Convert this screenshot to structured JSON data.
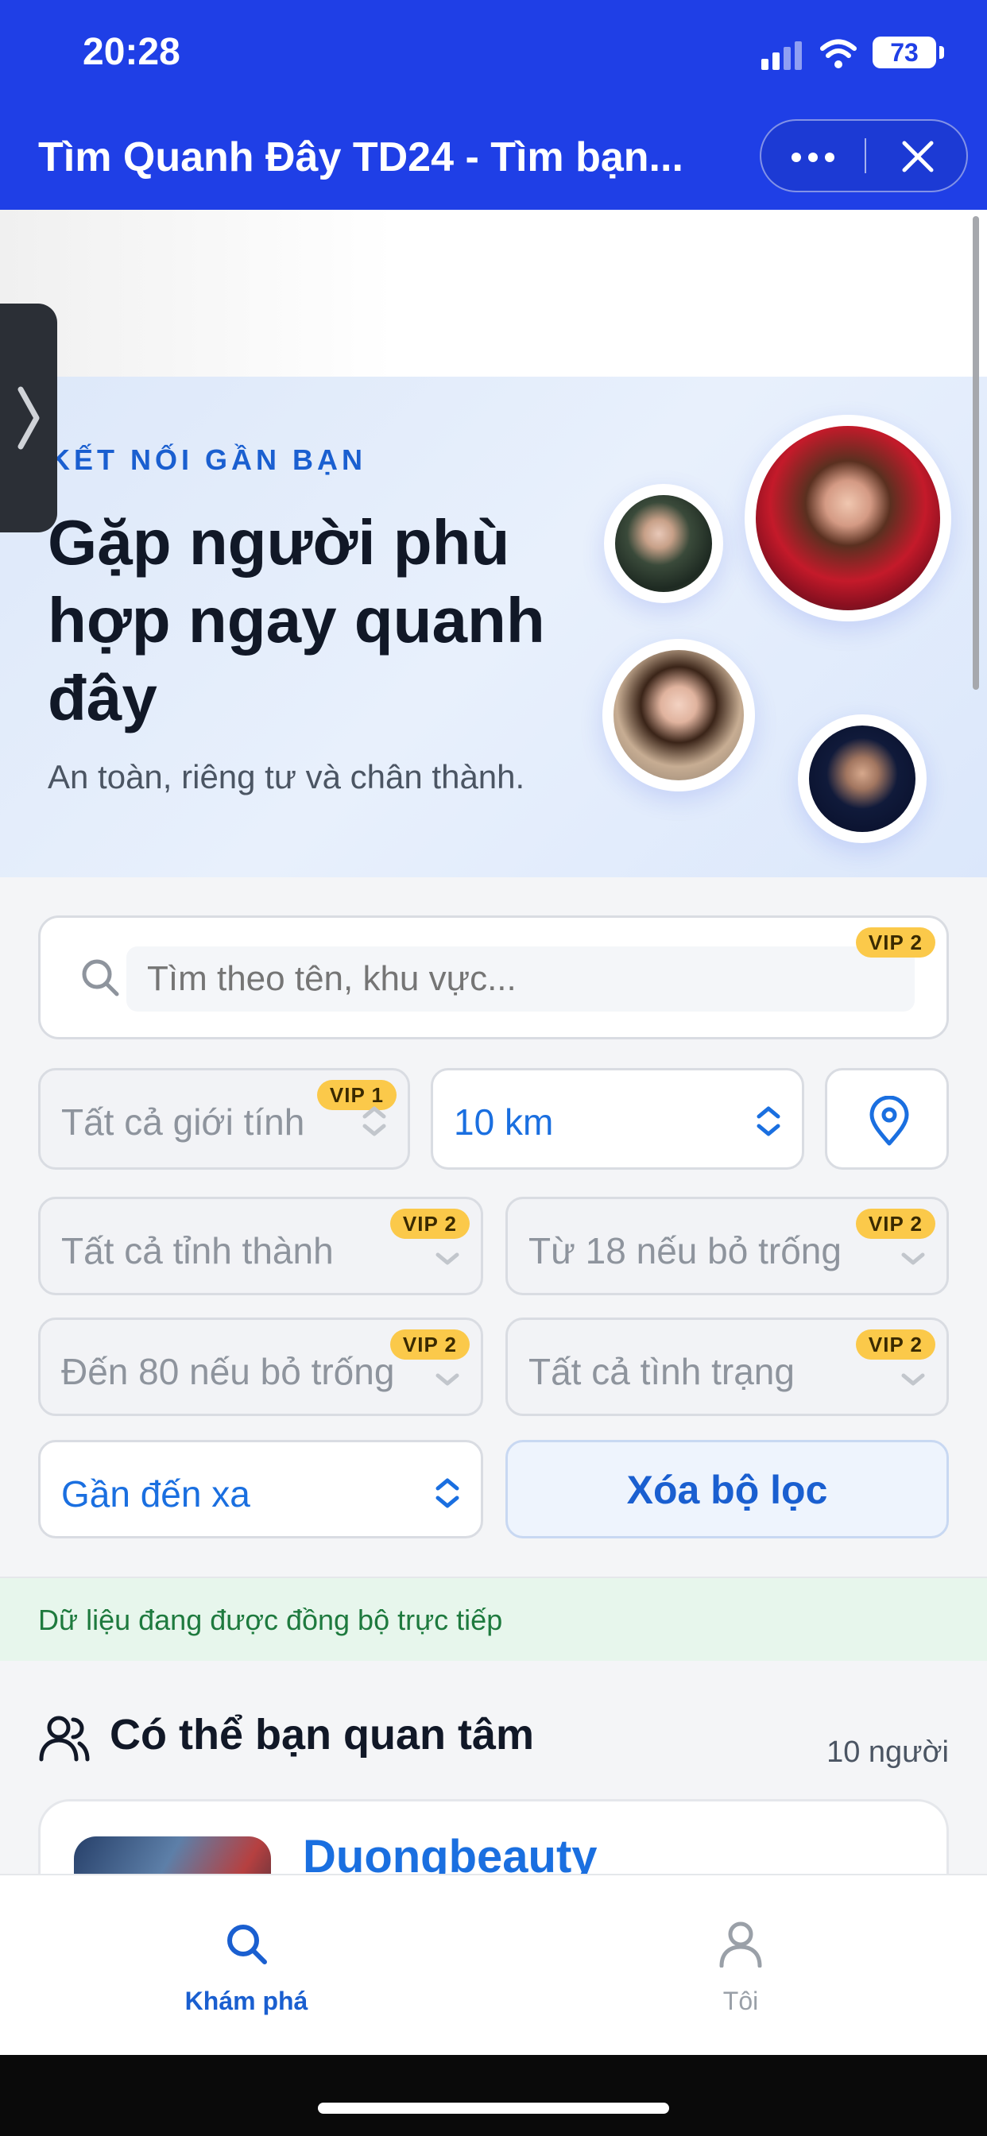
{
  "status_bar": {
    "time": "20:28",
    "battery": "73"
  },
  "header": {
    "title": "Tìm Quanh Đây TD24 - Tìm bạn..."
  },
  "hero": {
    "eyebrow": "KẾT NỐI GẦN BẠN",
    "title": "Gặp người phù hợp ngay quanh đây",
    "subtitle": "An toàn, riêng tư và chân thành."
  },
  "search": {
    "placeholder": "Tìm theo tên, khu vực...",
    "badge": "VIP 2"
  },
  "filters": {
    "gender": {
      "value": "Tất cả giới tính",
      "badge": "VIP 1"
    },
    "distance": {
      "value": "10 km"
    },
    "province": {
      "value": "Tất cả tỉnh thành",
      "badge": "VIP 2"
    },
    "age_from": {
      "value": "Từ 18 nếu bỏ trống",
      "badge": "VIP 2"
    },
    "age_to": {
      "value": "Đến 80 nếu bỏ trống",
      "badge": "VIP 2"
    },
    "status": {
      "value": "Tất cả tình trạng",
      "badge": "VIP 2"
    },
    "sort": {
      "value": "Gần đến xa"
    },
    "clear_label": "Xóa bộ lọc"
  },
  "sync_notice": "Dữ liệu đang được đồng bộ trực tiếp",
  "section": {
    "title": "Có thể bạn quan tâm",
    "count": "10 người"
  },
  "card": {
    "name": "Duongbeauty"
  },
  "tabbar": {
    "explore": "Khám phá",
    "me": "Tôi"
  },
  "colors": {
    "brand": "#1f3fe6",
    "accent": "#1a6fe0",
    "vip": "#fbc94a",
    "sync_bg": "#e7f6ec"
  }
}
